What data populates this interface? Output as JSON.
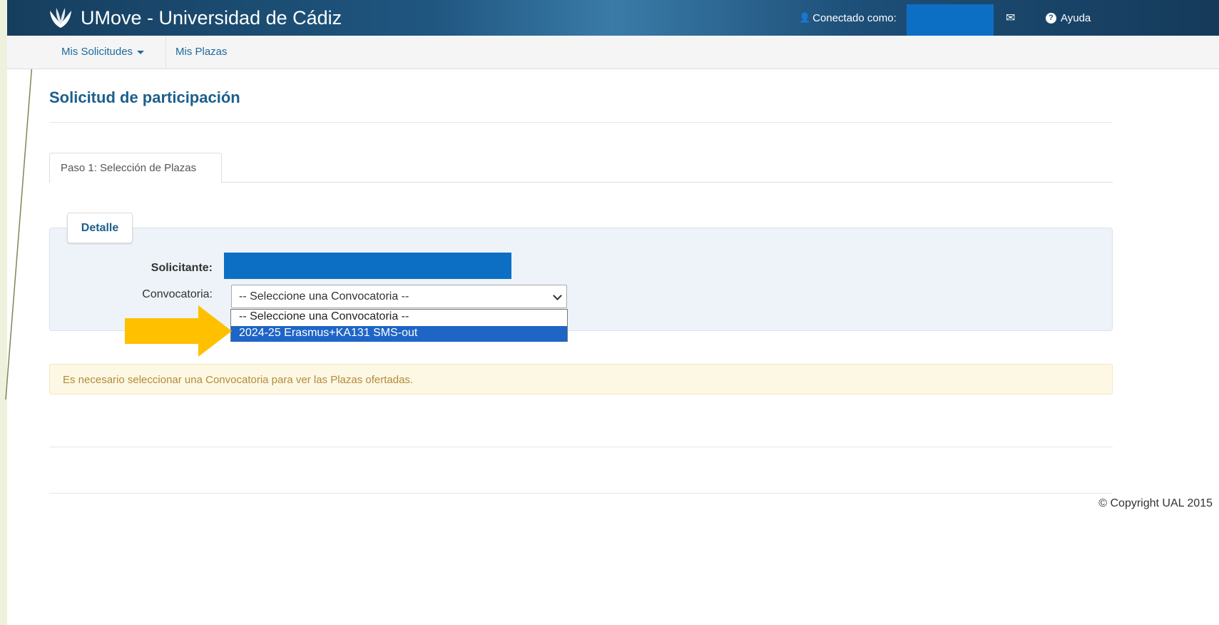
{
  "navbar": {
    "title": "UMove - Universidad de Cádiz",
    "connected_label": "Conectado como:",
    "help_label": "Ayuda"
  },
  "subnav": {
    "solicitudes": "Mis Solicitudes",
    "plazas": "Mis Plazas"
  },
  "page": {
    "title": "Solicitud de participación",
    "tab": "Paso 1: Selección de Plazas"
  },
  "detail": {
    "legend": "Detalle",
    "solicitante_label": "Solicitante:",
    "convocatoria_label": "Convocatoria:",
    "convocatoria_value": "-- Seleccione una Convocatoria --",
    "options": [
      "-- Seleccione una Convocatoria --",
      "2024-25 Erasmus+KA131 SMS-out"
    ]
  },
  "alert": "Es necesario seleccionar una Convocatoria para ver las Plazas ofertadas.",
  "footer": "© Copyright UAL 2015",
  "colors": {
    "arrow": "#ffc000",
    "selected_option": "#1e65c6",
    "redaction": "#0d6fc4"
  }
}
